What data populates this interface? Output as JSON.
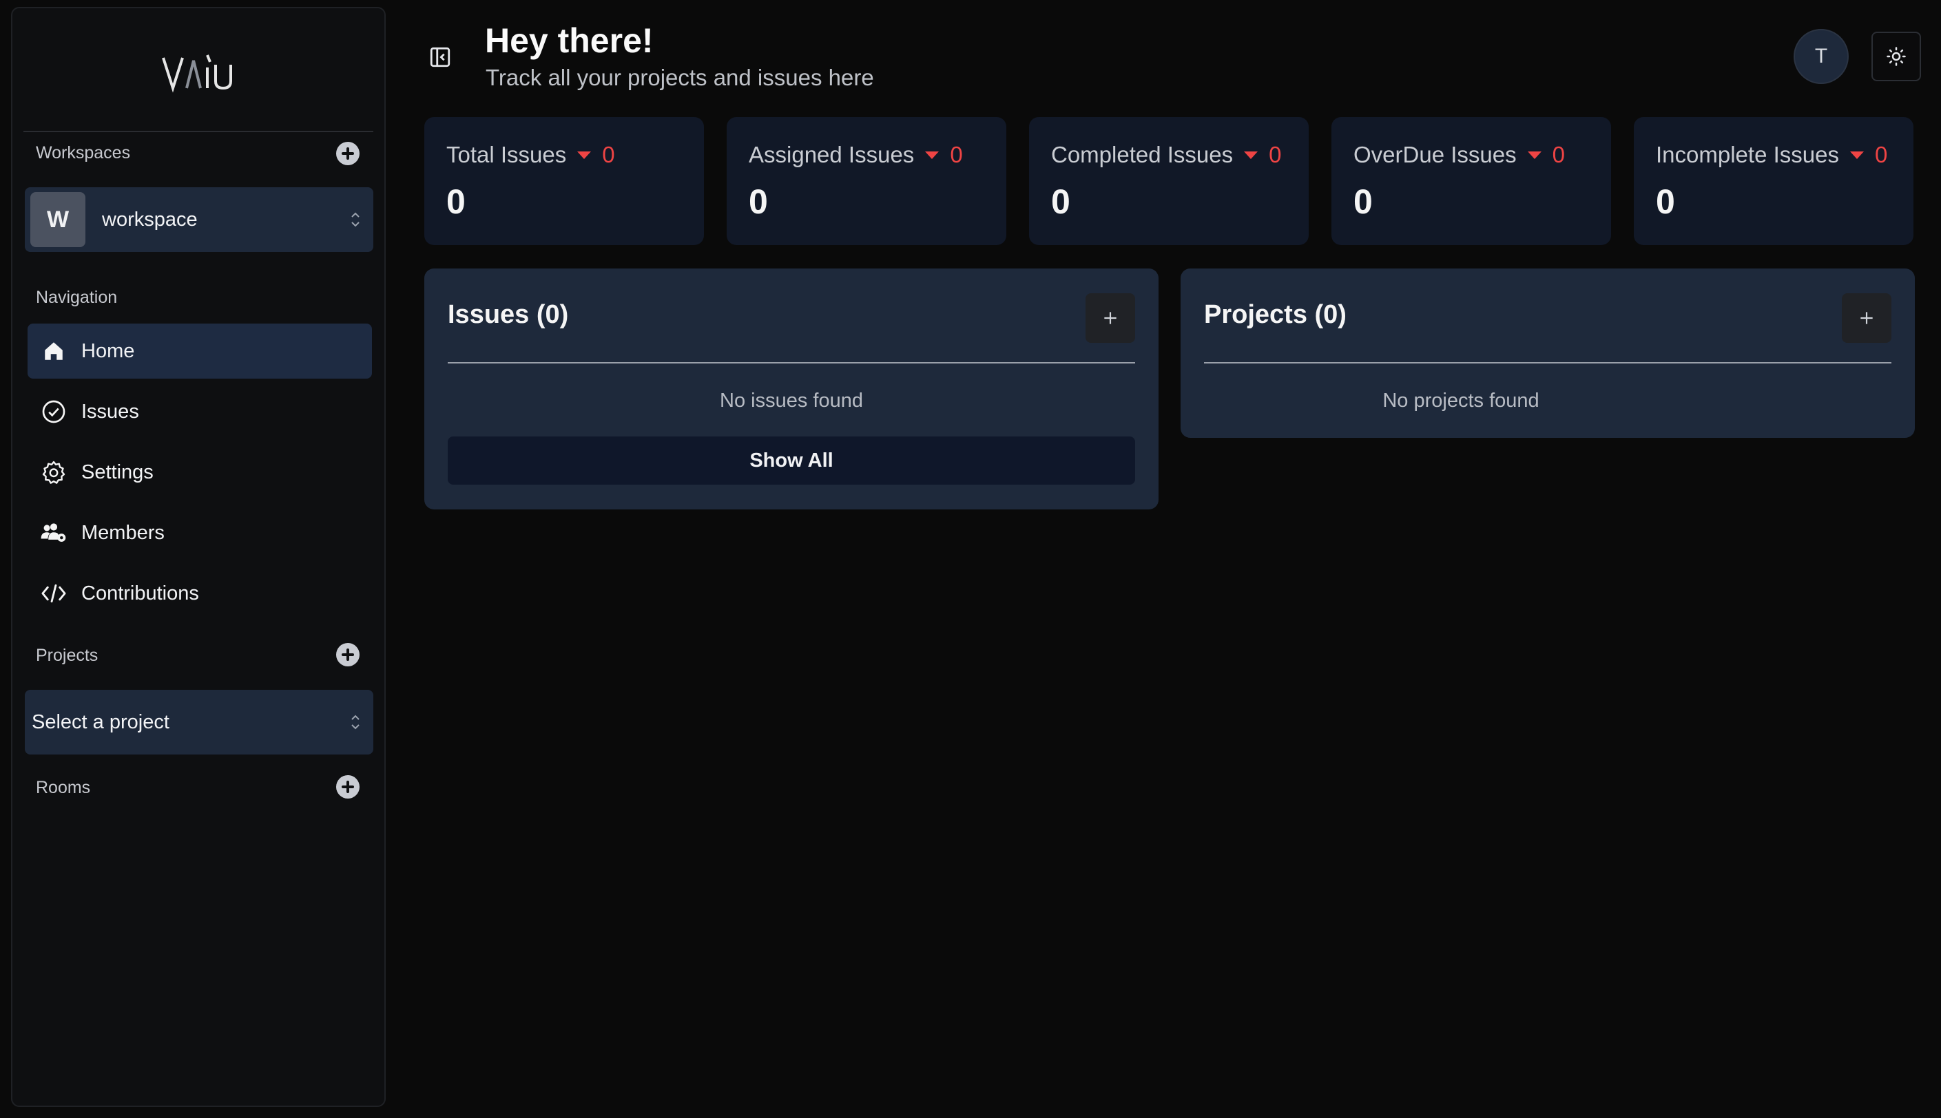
{
  "app": {
    "logo_text": "VAIU"
  },
  "sidebar": {
    "workspaces_label": "Workspaces",
    "workspace": {
      "initial": "W",
      "name": "workspace"
    },
    "navigation_label": "Navigation",
    "nav_items": [
      {
        "label": "Home",
        "icon": "home-icon",
        "active": true
      },
      {
        "label": "Issues",
        "icon": "check-circle-icon",
        "active": false
      },
      {
        "label": "Settings",
        "icon": "gear-icon",
        "active": false
      },
      {
        "label": "Members",
        "icon": "users-gear-icon",
        "active": false
      },
      {
        "label": "Contributions",
        "icon": "code-icon",
        "active": false
      }
    ],
    "projects_label": "Projects",
    "project_select_placeholder": "Select a project",
    "rooms_label": "Rooms"
  },
  "header": {
    "title": "Hey there!",
    "subtitle": "Track all your projects and issues here",
    "user_initial": "T"
  },
  "stats": [
    {
      "label": "Total Issues",
      "delta": "0",
      "value": "0"
    },
    {
      "label": "Assigned Issues",
      "delta": "0",
      "value": "0"
    },
    {
      "label": "Completed Issues",
      "delta": "0",
      "value": "0"
    },
    {
      "label": "OverDue Issues",
      "delta": "0",
      "value": "0"
    },
    {
      "label": "Incomplete Issues",
      "delta": "0",
      "value": "0"
    }
  ],
  "issues_panel": {
    "title": "Issues (0)",
    "empty_text": "No issues found",
    "show_all_label": "Show All"
  },
  "projects_panel": {
    "title": "Projects (0)",
    "empty_text": "No projects found"
  },
  "colors": {
    "accent_red": "#ef4444",
    "card_bg": "#111827",
    "panel_bg": "#1e293b"
  }
}
